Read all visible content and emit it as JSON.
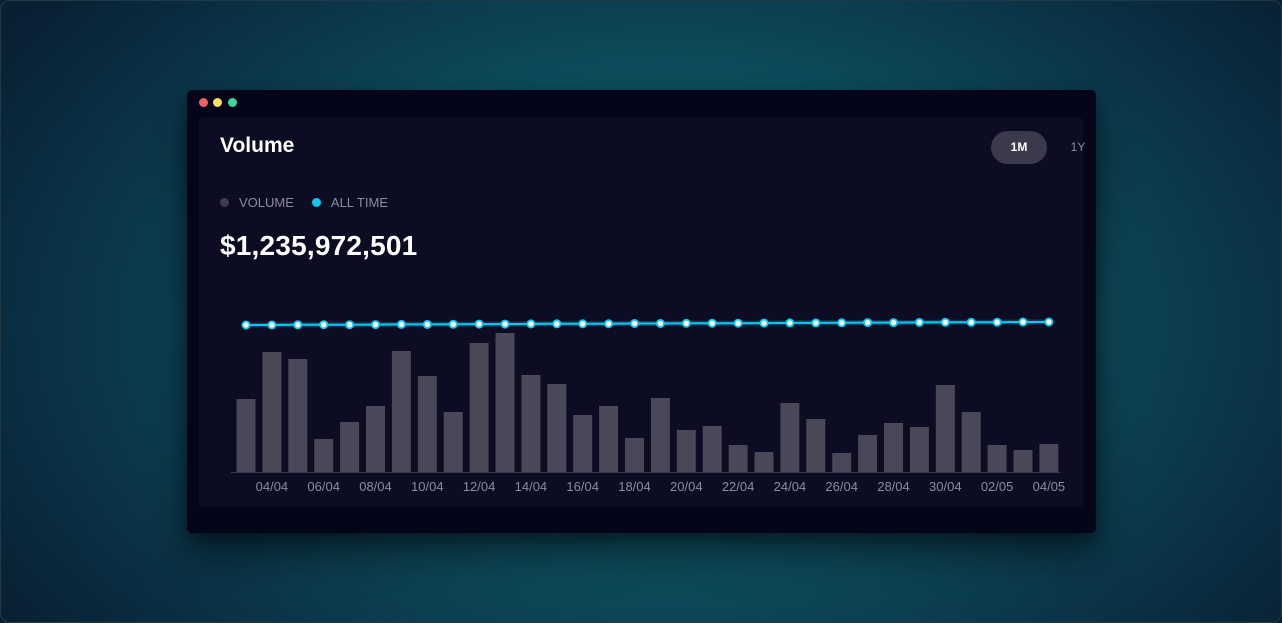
{
  "window": {
    "controls": [
      {
        "name": "close",
        "color": "#f25f6b"
      },
      {
        "name": "minimize",
        "color": "#f5e26b"
      },
      {
        "name": "maximize",
        "color": "#3fd59a"
      }
    ]
  },
  "header": {
    "title": "Volume",
    "range_buttons": [
      {
        "label": "1M",
        "active": true
      },
      {
        "label": "1Y",
        "active": false
      }
    ]
  },
  "legend": [
    {
      "label": "VOLUME",
      "color": "#3e3d4e"
    },
    {
      "label": "ALL TIME",
      "color": "#11c8f3"
    }
  ],
  "total_value": "$1,235,972,501",
  "colors": {
    "bar": "#4a4858",
    "line": "#11c8f3",
    "background": "#0c0c22"
  },
  "chart_data": {
    "type": "bar",
    "title": "Volume",
    "xlabel": "",
    "ylabel": "",
    "x_tick_labels": [
      "04/04",
      "06/04",
      "08/04",
      "10/04",
      "12/04",
      "14/04",
      "16/04",
      "18/04",
      "20/04",
      "22/04",
      "24/04",
      "26/04",
      "28/04",
      "30/04",
      "02/05",
      "04/05"
    ],
    "series": [
      {
        "name": "VOLUME",
        "type": "bar",
        "values": [
          73,
          120,
          113,
          33,
          50,
          66,
          121,
          96,
          60,
          129,
          139,
          97,
          88,
          57,
          66,
          34,
          74,
          42,
          46,
          27,
          20,
          69,
          53,
          19,
          37,
          49,
          45,
          87,
          60,
          27,
          22,
          28
        ]
      },
      {
        "name": "ALL TIME",
        "type": "line",
        "values": [
          1199,
          1199,
          1199.5,
          1200,
          1200,
          1200.5,
          1201,
          1201,
          1201.5,
          1202,
          1202,
          1202.5,
          1203,
          1203,
          1203.5,
          1204,
          1204,
          1204.5,
          1205,
          1205,
          1205.5,
          1206,
          1206,
          1206.5,
          1207,
          1207,
          1207.5,
          1208,
          1208,
          1208.5,
          1209,
          1209
        ]
      }
    ],
    "ylim": [
      0,
      150
    ],
    "grid": false,
    "legend_position": "top-left"
  }
}
